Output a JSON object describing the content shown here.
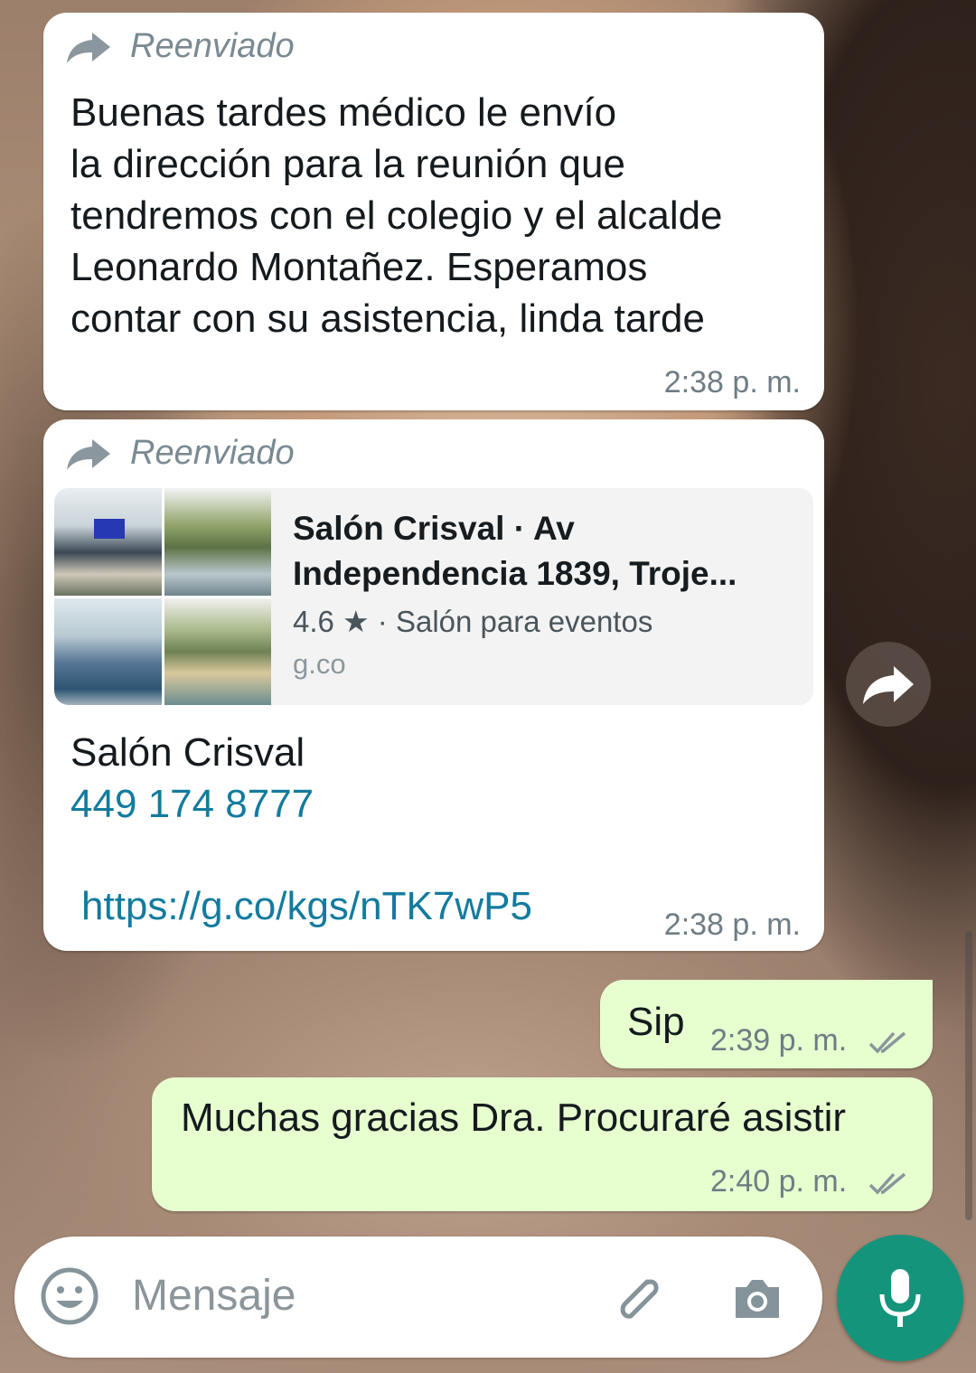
{
  "messages": [
    {
      "forwarded_label": "Reenviado",
      "text": "Buenas tardes médico le envío\nla dirección para la reunión que\ntendremos con el colegio y el alcalde\nLeonardo Montañez. Esperamos\ncontar con su asistencia, linda tarde",
      "time": "2:38 p. m."
    },
    {
      "forwarded_label": "Reenviado",
      "preview": {
        "title": "Salón Crisval · Av Independencia 1839, Troje...",
        "subtitle": "4.6 ★ · Salón para eventos",
        "domain": "g.co"
      },
      "name": "Salón Crisval",
      "phone": "449 174 8777",
      "url": "https://g.co/kgs/nTK7wP5",
      "time": "2:38 p. m."
    },
    {
      "text": "Sip",
      "time": "2:39 p. m."
    },
    {
      "text": "Muchas gracias Dra. Procuraré asistir",
      "time": "2:40 p. m."
    }
  ],
  "composer": {
    "placeholder": "Mensaje"
  },
  "icons": {
    "forward": "forward-arrow-icon",
    "share": "share-icon",
    "emoji": "emoji-icon",
    "attach": "paperclip-icon",
    "camera": "camera-icon",
    "mic": "microphone-icon",
    "read": "double-check-icon"
  },
  "colors": {
    "outgoing_bubble": "#e7fecf",
    "incoming_bubble": "#ffffff",
    "link": "#137b9e",
    "mic_button": "#15947c",
    "read_ticks": "#8a969c"
  }
}
